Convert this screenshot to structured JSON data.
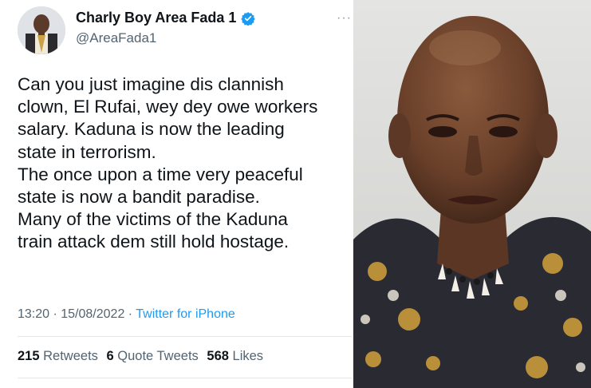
{
  "author": {
    "display_name": "Charly Boy Area Fada 1",
    "handle": "@AreaFada1"
  },
  "tweet": {
    "lines": [
      "Can you just imagine dis clannish",
      "clown, El Rufai, wey dey owe workers",
      "salary. Kaduna is now the leading",
      "state in terrorism.",
      "The once upon a time very peaceful",
      "state is now a bandit paradise.",
      "Many of the victims of the Kaduna",
      "train attack dem still hold hostage."
    ],
    "time": "13:20 · 15/08/2022 ·",
    "source": "Twitter for iPhone"
  },
  "stats": {
    "retweets_count": "215",
    "retweets_label": "Retweets",
    "quotes_count": "6",
    "quotes_label": "Quote Tweets",
    "likes_count": "568",
    "likes_label": "Likes"
  },
  "icons": {
    "verified": "verified-badge-icon",
    "more": "more-options-icon"
  },
  "colors": {
    "accent": "#1d9bf0",
    "text": "#0f1419",
    "muted": "#536471"
  }
}
